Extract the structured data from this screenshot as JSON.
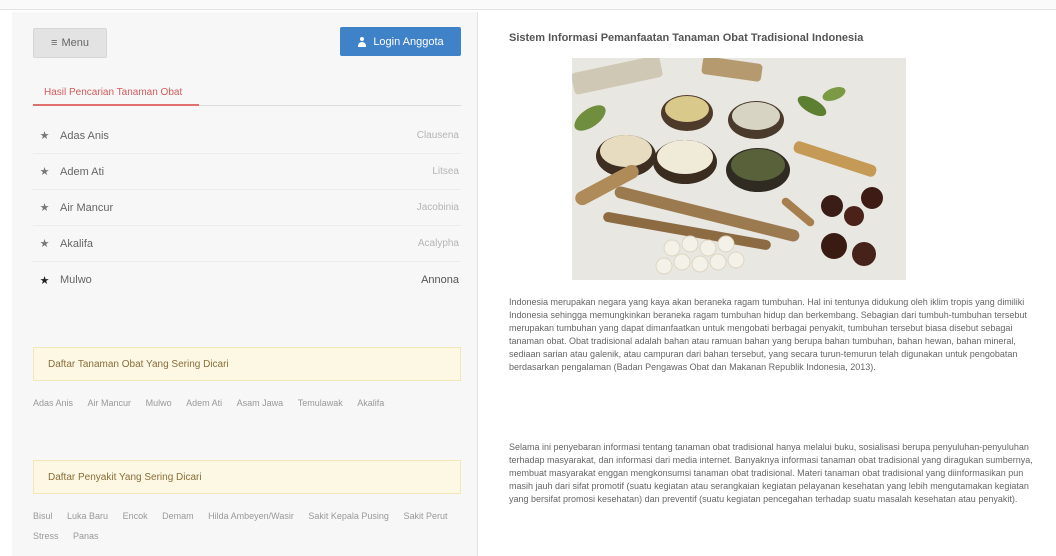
{
  "header": {
    "menu_label": "Menu",
    "menu_icon": "hamburger-icon",
    "login_label": "Login Anggota",
    "login_icon": "user-icon",
    "accent_color": "#3f82c8"
  },
  "search": {
    "tab_label": "Hasil Pencarian Tanaman Obat",
    "results": [
      {
        "name": "Adas Anis",
        "latin": "Clausena"
      },
      {
        "name": "Adem Ati",
        "latin": "Litsea"
      },
      {
        "name": "Air Mancur",
        "latin": "Jacobinia"
      },
      {
        "name": "Akalifa",
        "latin": "Acalypha"
      },
      {
        "name": "Mulwo",
        "latin": "Annona"
      }
    ]
  },
  "popular_plants": {
    "heading": "Daftar Tanaman Obat Yang Sering Dicari",
    "tags": [
      "Adas Anis",
      "Air Mancur",
      "Mulwo",
      "Adem Ati",
      "Asam Jawa",
      "Temulawak",
      "Akalifa"
    ]
  },
  "popular_diseases": {
    "heading": "Daftar Penyakit Yang Sering Dicari",
    "tags": [
      "Bisul",
      "Luka Baru",
      "Encok",
      "Demam",
      "Hilda Ambeyen/Wasir",
      "Sakit Kepala Pusing",
      "Sakit Perut",
      "Stress",
      "Panas"
    ]
  },
  "article": {
    "title": "Sistem Informasi Pemanfaatan Tanaman Obat Tradisional Indonesia",
    "image_alt": "herbal-ingredients",
    "paragraph_1": "Indonesia merupakan negara yang kaya akan beraneka ragam tumbuhan. Hal ini tentunya didukung oleh iklim tropis yang dimiliki Indonesia sehingga memungkinkan beraneka ragam tumbuhan hidup dan berkembang. Sebagian dari tumbuh-tumbuhan tersebut merupakan tumbuhan yang dapat dimanfaatkan untuk mengobati berbagai penyakit, tumbuhan tersebut biasa disebut sebagai tanaman obat. Obat tradisional adalah bahan atau ramuan bahan yang berupa bahan tumbuhan, bahan hewan, bahan mineral, sediaan sarian atau galenik, atau campuran dari bahan tersebut, yang secara turun-temurun telah digunakan untuk pengobatan berdasarkan pengalaman (Badan Pengawas Obat dan Makanan Republik Indonesia, 2013).",
    "paragraph_2": "Selama ini penyebaran informasi tentang tanaman obat tradisional hanya melalui buku, sosialisasi berupa penyuluhan-penyuluhan terhadap masyarakat, dan informasi dari media internet. Banyaknya informasi tanaman obat tradisional yang diragukan sumbernya, membuat masyarakat enggan mengkonsumsi tanaman obat tradisional. Materi tanaman obat tradisional yang diinformasikan pun masih jauh dari sifat promotif (suatu kegiatan atau serangkaian kegiatan pelayanan kesehatan yang lebih mengutamakan kegiatan yang bersifat promosi kesehatan) dan preventif (suatu kegiatan pencegahan terhadap suatu masalah kesehatan atau penyakit)."
  }
}
